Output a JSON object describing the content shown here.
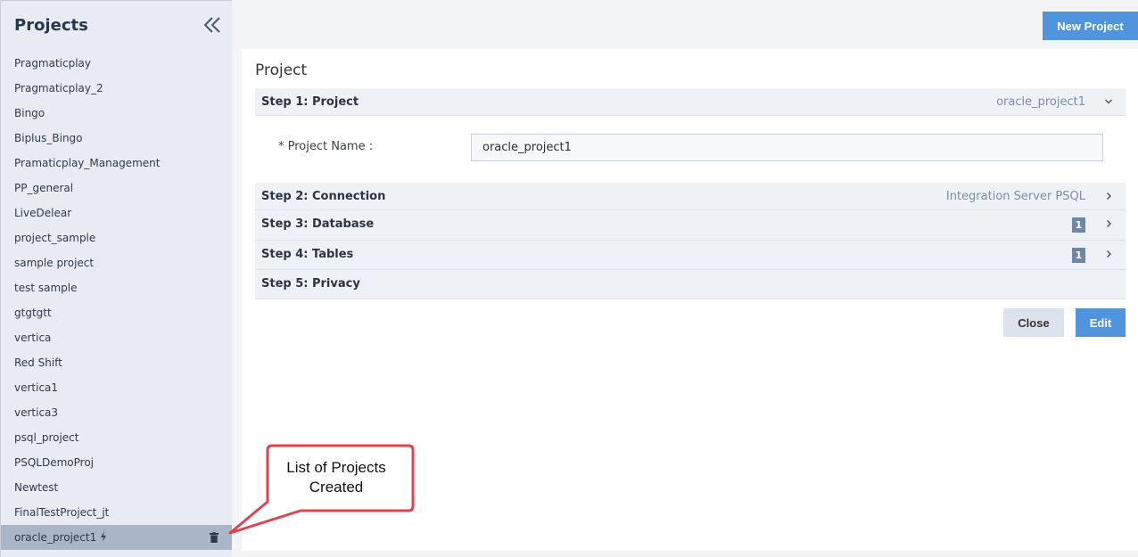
{
  "sidebar": {
    "title": "Projects",
    "items": [
      {
        "label": "Pragmaticplay"
      },
      {
        "label": "Pragmaticplay_2"
      },
      {
        "label": "Bingo"
      },
      {
        "label": "Biplus_Bingo"
      },
      {
        "label": "Pramaticplay_Management"
      },
      {
        "label": "PP_general"
      },
      {
        "label": "LiveDelear"
      },
      {
        "label": "project_sample"
      },
      {
        "label": "sample project"
      },
      {
        "label": "test sample"
      },
      {
        "label": "gtgtgtt"
      },
      {
        "label": "vertica"
      },
      {
        "label": "Red Shift"
      },
      {
        "label": "vertica1"
      },
      {
        "label": "vertica3"
      },
      {
        "label": "psql_project"
      },
      {
        "label": "PSQLDemoProj"
      },
      {
        "label": "Newtest"
      },
      {
        "label": "FinalTestProject_jt"
      }
    ],
    "active_item": {
      "label": "oracle_project1",
      "icon": "bolt-icon",
      "action_icon": "trash-icon"
    }
  },
  "toolbar": {
    "new_project_label": "New Project"
  },
  "panel": {
    "title": "Project",
    "steps": [
      {
        "label": "Step 1: Project",
        "value": "oracle_project1",
        "expanded": true
      },
      {
        "label": "Step 2: Connection",
        "value": "Integration Server PSQL"
      },
      {
        "label": "Step 3: Database",
        "badge": "1"
      },
      {
        "label": "Step 4: Tables",
        "badge": "1"
      },
      {
        "label": "Step 5: Privacy"
      }
    ],
    "project_name_label": "* Project Name :",
    "project_name_value": "oracle_project1",
    "close_label": "Close",
    "edit_label": "Edit"
  },
  "callout": {
    "line1": "List of Projects",
    "line2": "Created"
  },
  "colors": {
    "accent": "#4f94dc",
    "sidebar_bg": "#e8ecf2",
    "active_item_bg": "#aab5c8",
    "callout_border": "#e0454f",
    "badge_bg": "#6e87a4"
  }
}
